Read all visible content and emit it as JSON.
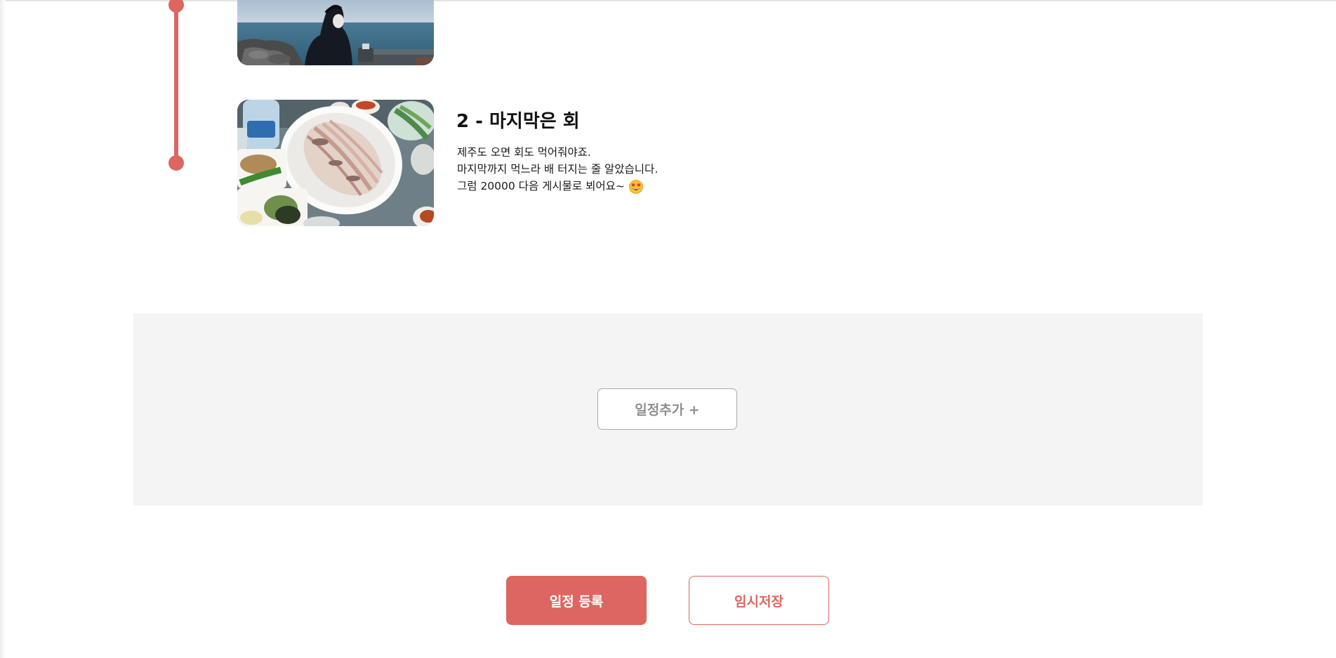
{
  "timeline": {
    "entries": [
      {
        "photo": "seaside-photo",
        "title": "",
        "lines": []
      },
      {
        "photo": "sashimi-photo",
        "title": "2 - 마지막은 회",
        "lines": [
          "제주도 오면 회도 먹어줘야죠.",
          "마지막까지 먹느라 배 터지는 줄 알았습니다.",
          "그럼 20000 다음 게시물로 뵈어요~"
        ],
        "emoji": "star-struck-emoji-icon"
      }
    ]
  },
  "add_panel": {
    "add_button_label": "일정추가 +"
  },
  "actions": {
    "register_label": "일정 등록",
    "draft_label": "임시저장"
  },
  "colors": {
    "accent": "#dd6660",
    "panel_bg": "#f4f4f4",
    "muted_text": "#8e8e8e"
  }
}
